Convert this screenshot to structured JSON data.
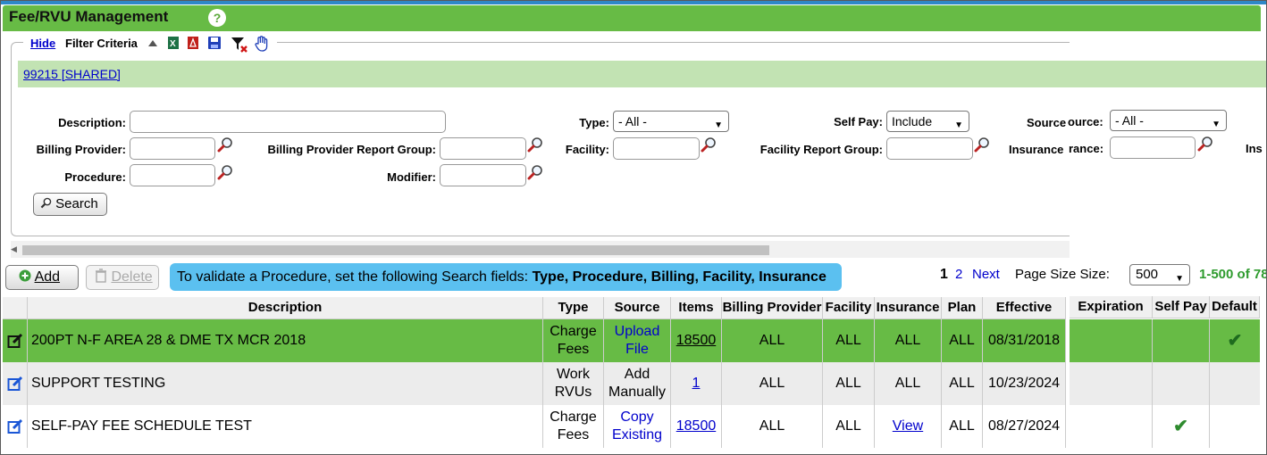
{
  "page": {
    "title": "Fee/RVU Management",
    "help": "?"
  },
  "filter": {
    "hide_link": "Hide",
    "label": "Filter Criteria",
    "shared_link": "99215 [SHARED]",
    "fields": {
      "description": "Description:",
      "billing_provider": "Billing Provider:",
      "procedure": "Procedure:",
      "billing_provider_report_group": "Billing Provider Report Group:",
      "modifier": "Modifier:",
      "type": "Type:",
      "facility": "Facility:",
      "self_pay": "Self Pay:",
      "facility_report_group": "Facility Report Group:",
      "source": "Source",
      "source_overlap": "ource:",
      "insurance": "Insurance",
      "insurance_overlap": "rance:",
      "ins_cut": "Ins"
    },
    "type_value": "- All -",
    "self_pay_value": "Include",
    "source_value": "- All -",
    "search_button": "Search"
  },
  "toolbar": {
    "add": "Add",
    "delete": "Delete",
    "tip_prefix": "To validate a Procedure, set the following Search fields: ",
    "tip_fields": "Type, Procedure, Billing, Facility, Insurance",
    "page1": "1",
    "page2": "2",
    "next": "Next",
    "page_size_label": "Page Size Size:",
    "page_size": "500",
    "count": "1-500 of 78"
  },
  "columns": {
    "description": "Description",
    "type": "Type",
    "source": "Source",
    "items": "Items",
    "billing_provider": "Billing Provider",
    "facility": "Facility",
    "insurance": "Insurance",
    "plan": "Plan",
    "effective": "Effective",
    "expiration": "Expiration",
    "self_pay": "Self Pay",
    "default": "Default"
  },
  "rows": [
    {
      "description": "200PT N-F AREA 28 & DME TX MCR 2018",
      "type_1": "Charge",
      "type_2": "Fees",
      "source_1": "Upload",
      "source_2": "File",
      "items": "18500",
      "billing_provider": "ALL",
      "facility": "ALL",
      "insurance": "ALL",
      "plan": "ALL",
      "effective": "08/31/2018",
      "self_pay": "",
      "default": "✔"
    },
    {
      "description": "SUPPORT TESTING",
      "type_1": "Work",
      "type_2": "RVUs",
      "source_1": "Add",
      "source_2": "Manually",
      "items": "1",
      "billing_provider": "ALL",
      "facility": "ALL",
      "insurance": "ALL",
      "plan": "ALL",
      "effective": "10/23/2024",
      "self_pay": "",
      "default": ""
    },
    {
      "description": "SELF-PAY FEE SCHEDULE TEST",
      "type_1": "Charge",
      "type_2": "Fees",
      "source_1": "Copy",
      "source_2": "Existing",
      "items": "18500",
      "billing_provider": "ALL",
      "facility": "ALL",
      "insurance": "View",
      "plan": "ALL",
      "effective": "08/27/2024",
      "self_pay": "✔",
      "default": ""
    }
  ],
  "colors": {
    "title_green": "#67bb45",
    "selected_row": "#67bb45",
    "alt_row": "#ececec",
    "tip_blue": "#5bc0f0",
    "link": "#0000cc"
  }
}
